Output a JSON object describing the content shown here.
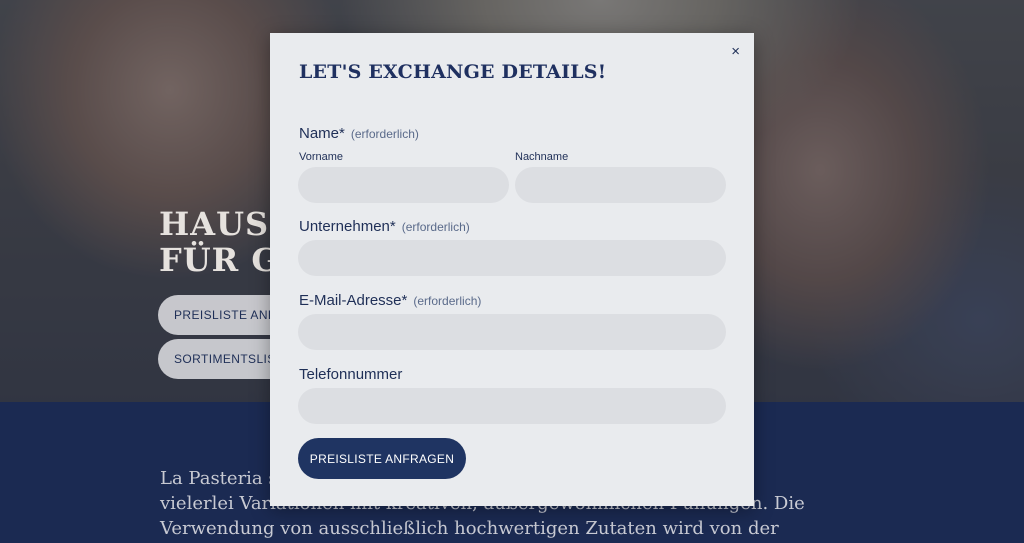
{
  "hero": {
    "title_line1": "HAUSG",
    "title_line2": "FÜR GA",
    "btn1": "PREISLISTE ANFRAGEN",
    "btn2": "SORTIMENTSLISTE"
  },
  "body_text": {
    "line1": "La Pasteria s                                                              alitäten in",
    "line2": "vielerlei Variationen mit kreativen, außergewöhnlichen Füllungen. Die",
    "line3": "Verwendung von ausschließlich hochwertigen Zutaten wird von der"
  },
  "modal": {
    "close": "×",
    "title": "LET'S EXCHANGE DETAILS!",
    "name": {
      "label": "Name*",
      "required": "(erforderlich)",
      "first_label": "Vorname",
      "last_label": "Nachname",
      "first_value": "",
      "last_value": ""
    },
    "company": {
      "label": "Unternehmen*",
      "required": "(erforderlich)",
      "value": ""
    },
    "email": {
      "label": "E-Mail-Adresse*",
      "required": "(erforderlich)",
      "value": ""
    },
    "phone": {
      "label": "Telefonnummer",
      "value": ""
    },
    "submit": "PREISLISTE ANFRAGEN"
  },
  "colors": {
    "navy": "#1f3462",
    "field_bg": "#dcdee2",
    "modal_bg": "#e9ebee"
  }
}
